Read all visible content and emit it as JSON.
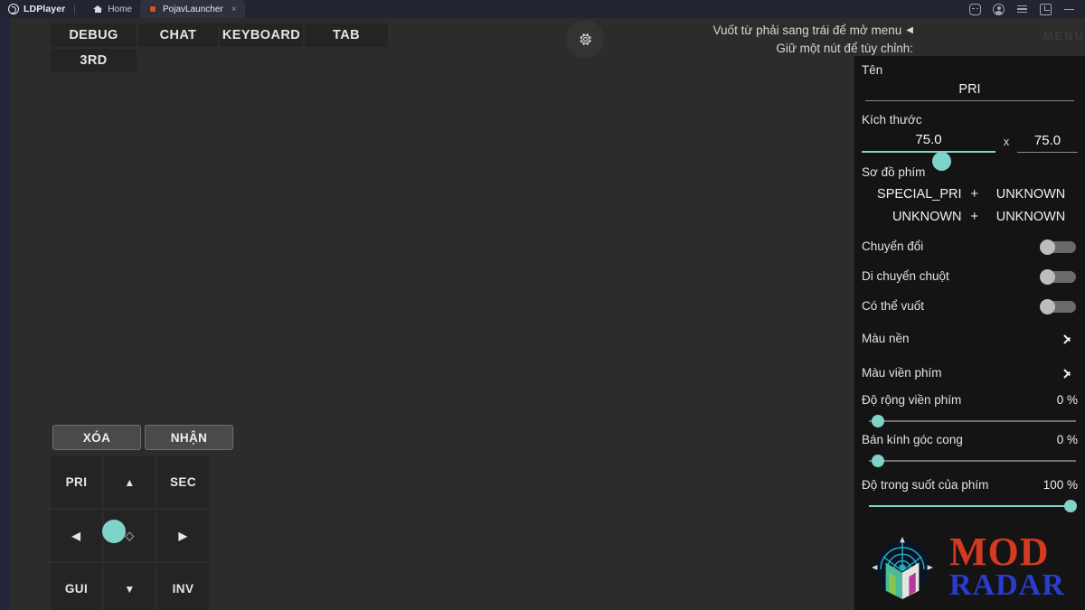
{
  "titlebar": {
    "brand": "LDPlayer",
    "tabs": [
      {
        "label": "Home",
        "icon": "home-icon",
        "active": false
      },
      {
        "label": "PojavLauncher",
        "icon": "app-icon",
        "active": true,
        "close": "×"
      }
    ],
    "window_controls": [
      "gamepad-icon",
      "account-icon",
      "menu-icon",
      "restore-icon",
      "minimize-icon"
    ]
  },
  "overlay": {
    "macro_buttons_row1": [
      "DEBUG",
      "CHAT",
      "KEYBOARD",
      "TAB"
    ],
    "macro_buttons_row2": [
      "3RD"
    ],
    "hint_line_1": "Vuốt từ phải sang trái để mở menu",
    "hint_arrow": "◀",
    "hint_line_2": "Giữ một nút để tùy chỉnh:",
    "ghost_menu_text": "MENU",
    "gear_icon": "gear-icon",
    "action_buttons": [
      "XÓA",
      "NHẬN"
    ],
    "dpad": [
      "PRI",
      "▲",
      "SEC",
      "◀",
      "◇",
      "▶",
      "GUI",
      "▼",
      "INV"
    ]
  },
  "panel": {
    "name_label": "Tên",
    "name_value": "PRI",
    "size_label": "Kích thước",
    "size_width": "75.0",
    "size_separator": "x",
    "size_height": "75.0",
    "size_slider_percent": 52,
    "keymap_label": "Sơ đồ phím",
    "keymap_rows": [
      {
        "key1": "SPECIAL_PRI",
        "plus": "+",
        "key2": "UNKNOWN"
      },
      {
        "key1": "UNKNOWN",
        "plus": "+",
        "key2": "UNKNOWN"
      }
    ],
    "toggles": [
      {
        "label": "Chuyển đổi",
        "on": false
      },
      {
        "label": "Di chuyển chuột",
        "on": false
      },
      {
        "label": "Có thể vuốt",
        "on": false
      }
    ],
    "color_rows": [
      {
        "label": "Màu nền",
        "icon": "chevron-right-icon"
      },
      {
        "label": "Màu viền phím",
        "icon": "chevron-right-icon"
      }
    ],
    "sliders": [
      {
        "label": "Độ rộng viền phím",
        "value": "0 %",
        "percent": 0
      },
      {
        "label": "Bán kính góc cong",
        "value": "0 %",
        "percent": 0
      },
      {
        "label": "Độ trong suốt của phím",
        "value": "100 %",
        "percent": 100
      }
    ]
  },
  "watermark": {
    "line1": "MOD",
    "line2": "RADAR",
    "logo_icon": "radar-compass-logo"
  },
  "colors": {
    "accent_teal": "#7fd3c8",
    "panel_bg": "#141414",
    "titlebar_bg": "#232431",
    "watermark_red": "#e03b20",
    "watermark_blue": "#2b3fd8"
  }
}
